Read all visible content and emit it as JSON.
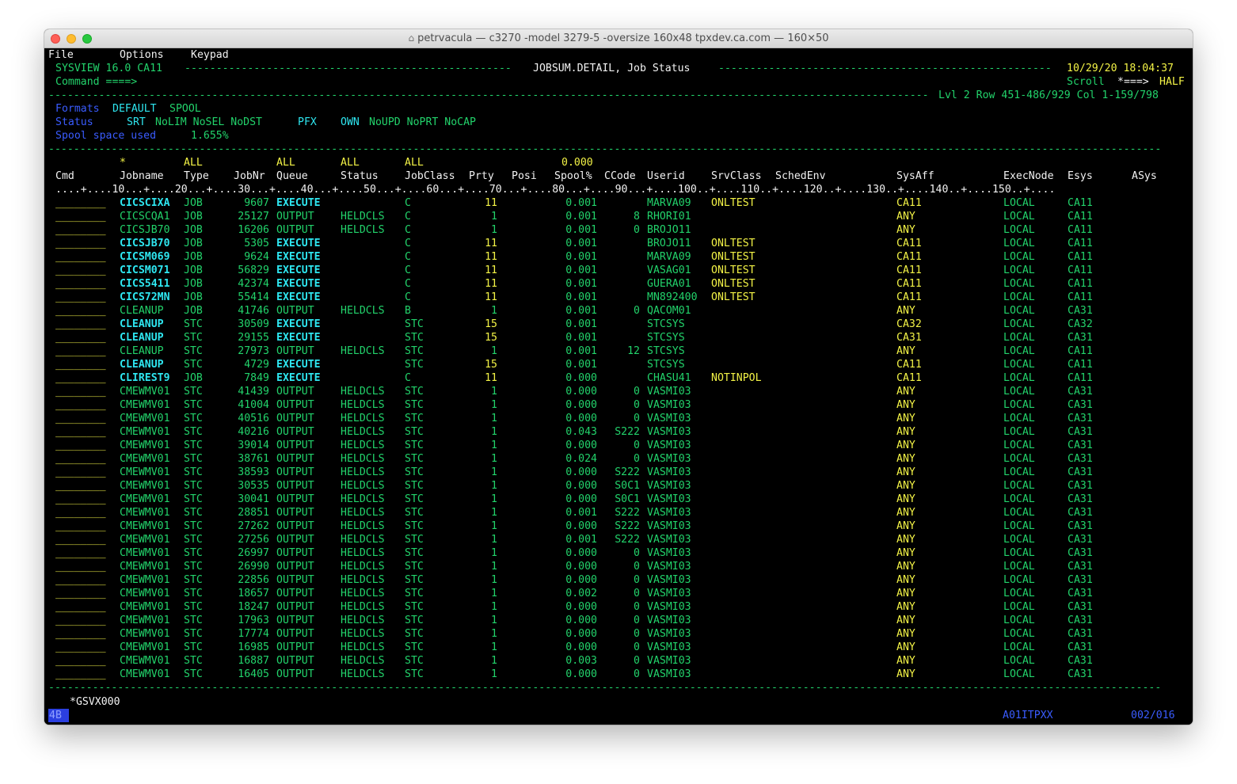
{
  "window": {
    "title": "petrvacula — c3270 -model 3279-5 -oversize 160x48 tpxdev.ca.com — 160×50"
  },
  "menu": [
    "File",
    "Options",
    "Keypad"
  ],
  "header": {
    "product": "SYSVIEW 16.0 CA11",
    "dashes_left": "----------------------------------------------------",
    "screen_title": "JOBSUM.DETAIL, Job Status",
    "dashes_right": "-----------------------------------------------------",
    "datetime": "10/29/20 18:04:37",
    "command_label": "Command ====>",
    "scroll_label": "Scroll",
    "scroll_arrow": "*===>",
    "scroll_value": "HALF",
    "dashes_info": "--------------------------------------------------------------------------------------------------------------------------------------------",
    "position_info": "Lvl 2 Row 451-486/929 Col 1-159/798"
  },
  "formats": {
    "label": "Formats",
    "value1": "DEFAULT",
    "value2": "SPOOL"
  },
  "status": {
    "label": "Status",
    "srt": "SRT",
    "flags1": "NoLIM NoSEL NoDST",
    "pfx": "PFX",
    "own": "OWN",
    "flags2": "NoUPD NoPRT NoCAP"
  },
  "spool": {
    "label": "Spool space used",
    "value": "1.655%"
  },
  "separator_line": "---------------------------------------------------------------------------------------------------------------------------------------------------------------------------------",
  "filters": {
    "jobname": "*",
    "type": "ALL",
    "queue": "ALL",
    "status": "ALL",
    "jobclass": "ALL",
    "spool": "0.000"
  },
  "columns": {
    "cmd": "Cmd",
    "jobname": "Jobname",
    "type": "Type",
    "jobnr": "JobNr",
    "queue": "Queue",
    "status": "Status",
    "jobclass": "JobClass",
    "prty": "Prty",
    "posi": "Posi",
    "spool": "Spool%",
    "ccode": "CCode",
    "userid": "Userid",
    "srvclass": "SrvClass",
    "schedenv": "SchedEnv",
    "sysaff": "SysAff",
    "execnode": "ExecNode",
    "esys": "Esys",
    "asys": "ASys"
  },
  "ruler": "....+....10...+....20...+....30...+....40...+....50...+....60...+....70...+....80...+....90...+....100..+....110..+....120..+....130..+....140..+....150..+....",
  "cmd_placeholder": "________",
  "rows": [
    {
      "jobname": "CICSCIXA",
      "type": "JOB",
      "jobnr": "9607",
      "queue": "EXECUTE",
      "status": "",
      "jobclass": "C",
      "prty": "11",
      "spool": "0.001",
      "ccode": "",
      "userid": "MARVA09",
      "srvclass": "ONLTEST",
      "sysaff": "CA11",
      "execnode": "LOCAL",
      "esys": "CA11"
    },
    {
      "jobname": "CICSCQA1",
      "type": "JOB",
      "jobnr": "25127",
      "queue": "OUTPUT",
      "status": "HELDCLS",
      "jobclass": "C",
      "prty": "1",
      "spool": "0.001",
      "ccode": "8",
      "userid": "RHORI01",
      "srvclass": "",
      "sysaff": "ANY",
      "execnode": "LOCAL",
      "esys": "CA11"
    },
    {
      "jobname": "CICSJB70",
      "type": "JOB",
      "jobnr": "16206",
      "queue": "OUTPUT",
      "status": "HELDCLS",
      "jobclass": "C",
      "prty": "1",
      "spool": "0.001",
      "ccode": "0",
      "userid": "BROJO11",
      "srvclass": "",
      "sysaff": "ANY",
      "execnode": "LOCAL",
      "esys": "CA11"
    },
    {
      "jobname": "CICSJB70",
      "type": "JOB",
      "jobnr": "5305",
      "queue": "EXECUTE",
      "status": "",
      "jobclass": "C",
      "prty": "11",
      "spool": "0.001",
      "ccode": "",
      "userid": "BROJO11",
      "srvclass": "ONLTEST",
      "sysaff": "CA11",
      "execnode": "LOCAL",
      "esys": "CA11"
    },
    {
      "jobname": "CICSM069",
      "type": "JOB",
      "jobnr": "9624",
      "queue": "EXECUTE",
      "status": "",
      "jobclass": "C",
      "prty": "11",
      "spool": "0.001",
      "ccode": "",
      "userid": "MARVA09",
      "srvclass": "ONLTEST",
      "sysaff": "CA11",
      "execnode": "LOCAL",
      "esys": "CA11"
    },
    {
      "jobname": "CICSM071",
      "type": "JOB",
      "jobnr": "56829",
      "queue": "EXECUTE",
      "status": "",
      "jobclass": "C",
      "prty": "11",
      "spool": "0.001",
      "ccode": "",
      "userid": "VASAG01",
      "srvclass": "ONLTEST",
      "sysaff": "CA11",
      "execnode": "LOCAL",
      "esys": "CA11"
    },
    {
      "jobname": "CICS5411",
      "type": "JOB",
      "jobnr": "42374",
      "queue": "EXECUTE",
      "status": "",
      "jobclass": "C",
      "prty": "11",
      "spool": "0.001",
      "ccode": "",
      "userid": "GUERA01",
      "srvclass": "ONLTEST",
      "sysaff": "CA11",
      "execnode": "LOCAL",
      "esys": "CA11"
    },
    {
      "jobname": "CICS72MN",
      "type": "JOB",
      "jobnr": "55414",
      "queue": "EXECUTE",
      "status": "",
      "jobclass": "C",
      "prty": "11",
      "spool": "0.001",
      "ccode": "",
      "userid": "MN892400",
      "srvclass": "ONLTEST",
      "sysaff": "CA11",
      "execnode": "LOCAL",
      "esys": "CA11"
    },
    {
      "jobname": "CLEANUP",
      "type": "JOB",
      "jobnr": "41746",
      "queue": "OUTPUT",
      "status": "HELDCLS",
      "jobclass": "B",
      "prty": "1",
      "spool": "0.001",
      "ccode": "0",
      "userid": "QACOM01",
      "srvclass": "",
      "sysaff": "ANY",
      "execnode": "LOCAL",
      "esys": "CA31"
    },
    {
      "jobname": "CLEANUP",
      "type": "STC",
      "jobnr": "30509",
      "queue": "EXECUTE",
      "status": "",
      "jobclass": "STC",
      "prty": "15",
      "spool": "0.001",
      "ccode": "",
      "userid": "STCSYS",
      "srvclass": "",
      "sysaff": "CA32",
      "execnode": "LOCAL",
      "esys": "CA32"
    },
    {
      "jobname": "CLEANUP",
      "type": "STC",
      "jobnr": "29155",
      "queue": "EXECUTE",
      "status": "",
      "jobclass": "STC",
      "prty": "15",
      "spool": "0.001",
      "ccode": "",
      "userid": "STCSYS",
      "srvclass": "",
      "sysaff": "CA31",
      "execnode": "LOCAL",
      "esys": "CA31"
    },
    {
      "jobname": "CLEANUP",
      "type": "STC",
      "jobnr": "27973",
      "queue": "OUTPUT",
      "status": "HELDCLS",
      "jobclass": "STC",
      "prty": "1",
      "spool": "0.001",
      "ccode": "12",
      "userid": "STCSYS",
      "srvclass": "",
      "sysaff": "ANY",
      "execnode": "LOCAL",
      "esys": "CA11"
    },
    {
      "jobname": "CLEANUP",
      "type": "STC",
      "jobnr": "4729",
      "queue": "EXECUTE",
      "status": "",
      "jobclass": "STC",
      "prty": "15",
      "spool": "0.001",
      "ccode": "",
      "userid": "STCSYS",
      "srvclass": "",
      "sysaff": "CA11",
      "execnode": "LOCAL",
      "esys": "CA11"
    },
    {
      "jobname": "CLIREST9",
      "type": "JOB",
      "jobnr": "7849",
      "queue": "EXECUTE",
      "status": "",
      "jobclass": "C",
      "prty": "11",
      "spool": "0.000",
      "ccode": "",
      "userid": "CHASU41",
      "srvclass": "NOTINPOL",
      "sysaff": "CA11",
      "execnode": "LOCAL",
      "esys": "CA11"
    },
    {
      "jobname": "CMEWMV01",
      "type": "STC",
      "jobnr": "41439",
      "queue": "OUTPUT",
      "status": "HELDCLS",
      "jobclass": "STC",
      "prty": "1",
      "spool": "0.000",
      "ccode": "0",
      "userid": "VASMI03",
      "srvclass": "",
      "sysaff": "ANY",
      "execnode": "LOCAL",
      "esys": "CA31"
    },
    {
      "jobname": "CMEWMV01",
      "type": "STC",
      "jobnr": "41004",
      "queue": "OUTPUT",
      "status": "HELDCLS",
      "jobclass": "STC",
      "prty": "1",
      "spool": "0.000",
      "ccode": "0",
      "userid": "VASMI03",
      "srvclass": "",
      "sysaff": "ANY",
      "execnode": "LOCAL",
      "esys": "CA31"
    },
    {
      "jobname": "CMEWMV01",
      "type": "STC",
      "jobnr": "40516",
      "queue": "OUTPUT",
      "status": "HELDCLS",
      "jobclass": "STC",
      "prty": "1",
      "spool": "0.000",
      "ccode": "0",
      "userid": "VASMI03",
      "srvclass": "",
      "sysaff": "ANY",
      "execnode": "LOCAL",
      "esys": "CA31"
    },
    {
      "jobname": "CMEWMV01",
      "type": "STC",
      "jobnr": "40216",
      "queue": "OUTPUT",
      "status": "HELDCLS",
      "jobclass": "STC",
      "prty": "1",
      "spool": "0.043",
      "ccode": "S222",
      "userid": "VASMI03",
      "srvclass": "",
      "sysaff": "ANY",
      "execnode": "LOCAL",
      "esys": "CA31"
    },
    {
      "jobname": "CMEWMV01",
      "type": "STC",
      "jobnr": "39014",
      "queue": "OUTPUT",
      "status": "HELDCLS",
      "jobclass": "STC",
      "prty": "1",
      "spool": "0.000",
      "ccode": "0",
      "userid": "VASMI03",
      "srvclass": "",
      "sysaff": "ANY",
      "execnode": "LOCAL",
      "esys": "CA31"
    },
    {
      "jobname": "CMEWMV01",
      "type": "STC",
      "jobnr": "38761",
      "queue": "OUTPUT",
      "status": "HELDCLS",
      "jobclass": "STC",
      "prty": "1",
      "spool": "0.024",
      "ccode": "0",
      "userid": "VASMI03",
      "srvclass": "",
      "sysaff": "ANY",
      "execnode": "LOCAL",
      "esys": "CA31"
    },
    {
      "jobname": "CMEWMV01",
      "type": "STC",
      "jobnr": "38593",
      "queue": "OUTPUT",
      "status": "HELDCLS",
      "jobclass": "STC",
      "prty": "1",
      "spool": "0.000",
      "ccode": "S222",
      "userid": "VASMI03",
      "srvclass": "",
      "sysaff": "ANY",
      "execnode": "LOCAL",
      "esys": "CA31"
    },
    {
      "jobname": "CMEWMV01",
      "type": "STC",
      "jobnr": "30535",
      "queue": "OUTPUT",
      "status": "HELDCLS",
      "jobclass": "STC",
      "prty": "1",
      "spool": "0.000",
      "ccode": "S0C1",
      "userid": "VASMI03",
      "srvclass": "",
      "sysaff": "ANY",
      "execnode": "LOCAL",
      "esys": "CA31"
    },
    {
      "jobname": "CMEWMV01",
      "type": "STC",
      "jobnr": "30041",
      "queue": "OUTPUT",
      "status": "HELDCLS",
      "jobclass": "STC",
      "prty": "1",
      "spool": "0.000",
      "ccode": "S0C1",
      "userid": "VASMI03",
      "srvclass": "",
      "sysaff": "ANY",
      "execnode": "LOCAL",
      "esys": "CA31"
    },
    {
      "jobname": "CMEWMV01",
      "type": "STC",
      "jobnr": "28851",
      "queue": "OUTPUT",
      "status": "HELDCLS",
      "jobclass": "STC",
      "prty": "1",
      "spool": "0.001",
      "ccode": "S222",
      "userid": "VASMI03",
      "srvclass": "",
      "sysaff": "ANY",
      "execnode": "LOCAL",
      "esys": "CA31"
    },
    {
      "jobname": "CMEWMV01",
      "type": "STC",
      "jobnr": "27262",
      "queue": "OUTPUT",
      "status": "HELDCLS",
      "jobclass": "STC",
      "prty": "1",
      "spool": "0.000",
      "ccode": "S222",
      "userid": "VASMI03",
      "srvclass": "",
      "sysaff": "ANY",
      "execnode": "LOCAL",
      "esys": "CA31"
    },
    {
      "jobname": "CMEWMV01",
      "type": "STC",
      "jobnr": "27256",
      "queue": "OUTPUT",
      "status": "HELDCLS",
      "jobclass": "STC",
      "prty": "1",
      "spool": "0.001",
      "ccode": "S222",
      "userid": "VASMI03",
      "srvclass": "",
      "sysaff": "ANY",
      "execnode": "LOCAL",
      "esys": "CA31"
    },
    {
      "jobname": "CMEWMV01",
      "type": "STC",
      "jobnr": "26997",
      "queue": "OUTPUT",
      "status": "HELDCLS",
      "jobclass": "STC",
      "prty": "1",
      "spool": "0.000",
      "ccode": "0",
      "userid": "VASMI03",
      "srvclass": "",
      "sysaff": "ANY",
      "execnode": "LOCAL",
      "esys": "CA31"
    },
    {
      "jobname": "CMEWMV01",
      "type": "STC",
      "jobnr": "26990",
      "queue": "OUTPUT",
      "status": "HELDCLS",
      "jobclass": "STC",
      "prty": "1",
      "spool": "0.000",
      "ccode": "0",
      "userid": "VASMI03",
      "srvclass": "",
      "sysaff": "ANY",
      "execnode": "LOCAL",
      "esys": "CA31"
    },
    {
      "jobname": "CMEWMV01",
      "type": "STC",
      "jobnr": "22856",
      "queue": "OUTPUT",
      "status": "HELDCLS",
      "jobclass": "STC",
      "prty": "1",
      "spool": "0.000",
      "ccode": "0",
      "userid": "VASMI03",
      "srvclass": "",
      "sysaff": "ANY",
      "execnode": "LOCAL",
      "esys": "CA31"
    },
    {
      "jobname": "CMEWMV01",
      "type": "STC",
      "jobnr": "18657",
      "queue": "OUTPUT",
      "status": "HELDCLS",
      "jobclass": "STC",
      "prty": "1",
      "spool": "0.002",
      "ccode": "0",
      "userid": "VASMI03",
      "srvclass": "",
      "sysaff": "ANY",
      "execnode": "LOCAL",
      "esys": "CA31"
    },
    {
      "jobname": "CMEWMV01",
      "type": "STC",
      "jobnr": "18247",
      "queue": "OUTPUT",
      "status": "HELDCLS",
      "jobclass": "STC",
      "prty": "1",
      "spool": "0.000",
      "ccode": "0",
      "userid": "VASMI03",
      "srvclass": "",
      "sysaff": "ANY",
      "execnode": "LOCAL",
      "esys": "CA31"
    },
    {
      "jobname": "CMEWMV01",
      "type": "STC",
      "jobnr": "17963",
      "queue": "OUTPUT",
      "status": "HELDCLS",
      "jobclass": "STC",
      "prty": "1",
      "spool": "0.000",
      "ccode": "0",
      "userid": "VASMI03",
      "srvclass": "",
      "sysaff": "ANY",
      "execnode": "LOCAL",
      "esys": "CA31"
    },
    {
      "jobname": "CMEWMV01",
      "type": "STC",
      "jobnr": "17774",
      "queue": "OUTPUT",
      "status": "HELDCLS",
      "jobclass": "STC",
      "prty": "1",
      "spool": "0.000",
      "ccode": "0",
      "userid": "VASMI03",
      "srvclass": "",
      "sysaff": "ANY",
      "execnode": "LOCAL",
      "esys": "CA31"
    },
    {
      "jobname": "CMEWMV01",
      "type": "STC",
      "jobnr": "16985",
      "queue": "OUTPUT",
      "status": "HELDCLS",
      "jobclass": "STC",
      "prty": "1",
      "spool": "0.000",
      "ccode": "0",
      "userid": "VASMI03",
      "srvclass": "",
      "sysaff": "ANY",
      "execnode": "LOCAL",
      "esys": "CA31"
    },
    {
      "jobname": "CMEWMV01",
      "type": "STC",
      "jobnr": "16887",
      "queue": "OUTPUT",
      "status": "HELDCLS",
      "jobclass": "STC",
      "prty": "1",
      "spool": "0.003",
      "ccode": "0",
      "userid": "VASMI03",
      "srvclass": "",
      "sysaff": "ANY",
      "execnode": "LOCAL",
      "esys": "CA31"
    },
    {
      "jobname": "CMEWMV01",
      "type": "STC",
      "jobnr": "16405",
      "queue": "OUTPUT",
      "status": "HELDCLS",
      "jobclass": "STC",
      "prty": "1",
      "spool": "0.000",
      "ccode": "0",
      "userid": "VASMI03",
      "srvclass": "",
      "sysaff": "ANY",
      "execnode": "LOCAL",
      "esys": "CA31"
    }
  ],
  "footer": {
    "message": "*GSVX000",
    "cursor": "4B",
    "terminal_id": "A01ITPXX",
    "cursor_pos": "002/016"
  }
}
